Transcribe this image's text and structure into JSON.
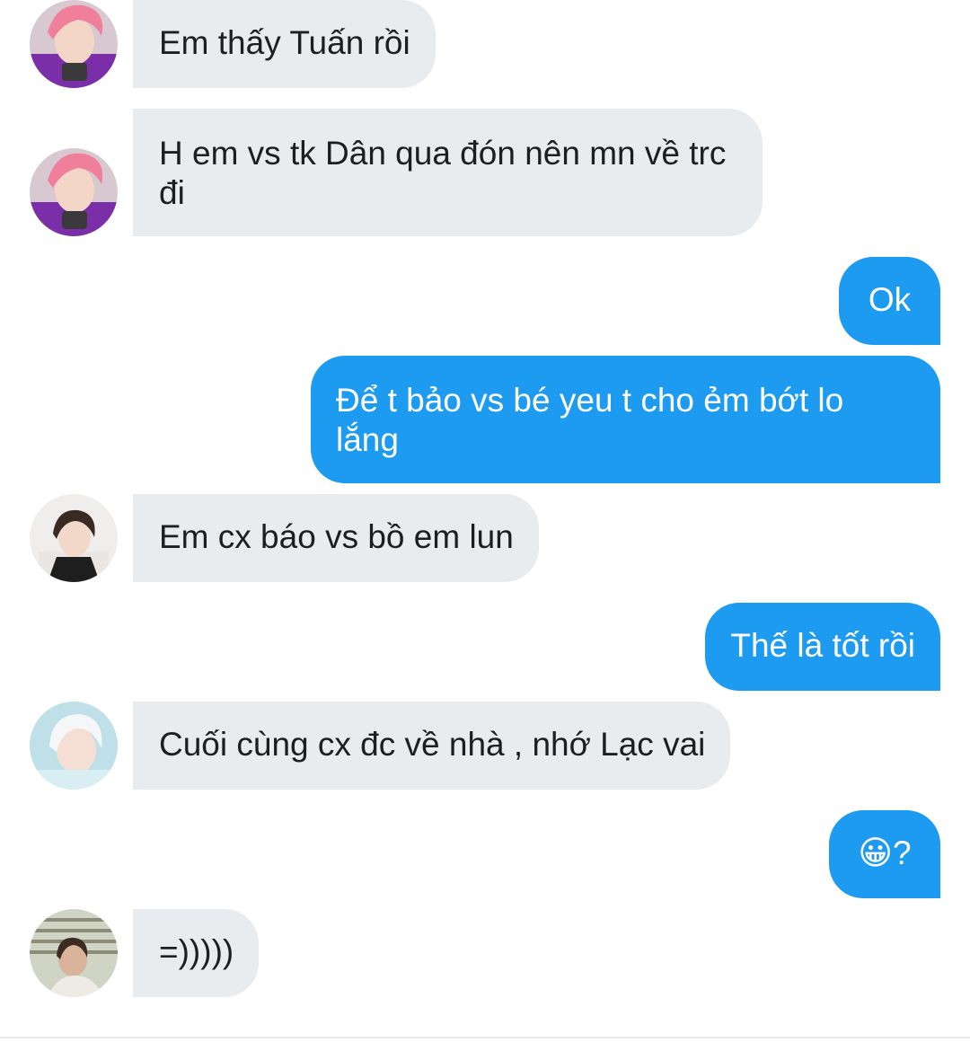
{
  "messages": [
    {
      "side": "in",
      "avatar": "avatar-pink-hair",
      "text": "Em thấy Tuấn rồi"
    },
    {
      "side": "in",
      "avatar": "avatar-pink-hair",
      "text": "H em vs tk Dân qua đón nên mn về trc đi"
    },
    {
      "side": "out",
      "text": "Ok"
    },
    {
      "side": "out",
      "text": "Để t bảo vs bé yeu t cho ẻm bớt lo lắng"
    },
    {
      "side": "in",
      "avatar": "avatar-dark-hair",
      "text": "Em cx báo vs bồ em lun"
    },
    {
      "side": "out",
      "text": "Thế là tốt rồi"
    },
    {
      "side": "in",
      "avatar": "avatar-white-hair",
      "text": "Cuối cùng cx đc về nhà , nhớ Lạc vai"
    },
    {
      "side": "out",
      "text": "😀?"
    },
    {
      "side": "in",
      "avatar": "avatar-window-light",
      "text": "=)))))"
    }
  ],
  "colors": {
    "incoming_bubble": "#e9ecef",
    "outgoing_bubble": "#1d9bf0",
    "incoming_text": "#1c1e21",
    "outgoing_text": "#ffffff"
  }
}
